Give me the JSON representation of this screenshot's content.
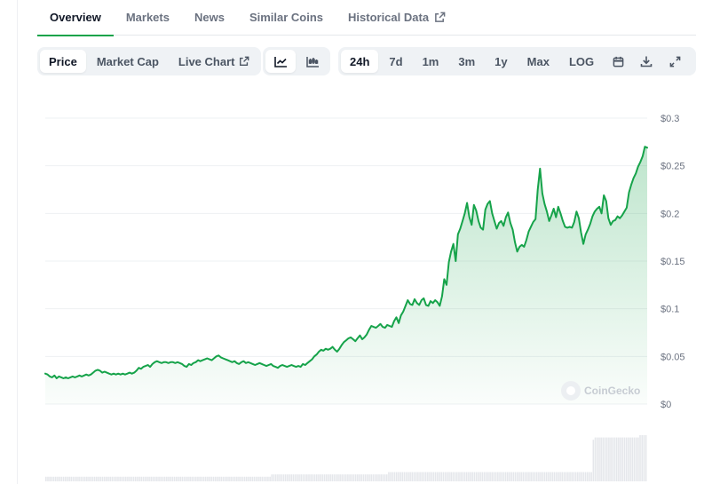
{
  "tabs": [
    {
      "label": "Overview",
      "active": true
    },
    {
      "label": "Markets"
    },
    {
      "label": "News"
    },
    {
      "label": "Similar Coins"
    },
    {
      "label": "Historical Data",
      "external": true
    }
  ],
  "toolbar": {
    "metrics": {
      "price": "Price",
      "market_cap": "Market Cap",
      "live_chart": "Live Chart"
    },
    "chart_types": [
      "line-chart-icon",
      "candlestick-icon"
    ],
    "ranges": [
      "24h",
      "7d",
      "1m",
      "3m",
      "1y",
      "Max",
      "LOG"
    ],
    "active_range": "24h",
    "actions": [
      "calendar-icon",
      "download-icon",
      "fullscreen-icon"
    ]
  },
  "colors": {
    "line": "#16a34a",
    "fill": "#16a34a",
    "volume": "#e5e7eb",
    "grid": "#eef0f3",
    "tick": "#6b7280"
  },
  "watermark": "CoinGecko",
  "chart_data": {
    "type": "area",
    "title": "",
    "xlabel": "",
    "ylabel": "",
    "ylim": [
      0,
      0.3
    ],
    "y_ticks": [
      0,
      0.05,
      0.1,
      0.15,
      0.2,
      0.25,
      0.3
    ],
    "y_tick_labels": [
      "$0",
      "$0.05",
      "$0.1",
      "$0.15",
      "$0.2",
      "$0.25",
      "$0.3"
    ],
    "grid": true,
    "series": [
      {
        "values": [
          0.032,
          0.031,
          0.029,
          0.028,
          0.03,
          0.027,
          0.029,
          0.028,
          0.027,
          0.028,
          0.027,
          0.028,
          0.029,
          0.028,
          0.029,
          0.03,
          0.029,
          0.03,
          0.031,
          0.03,
          0.031,
          0.033,
          0.035,
          0.036,
          0.035,
          0.033,
          0.034,
          0.033,
          0.032,
          0.031,
          0.032,
          0.031,
          0.032,
          0.031,
          0.032,
          0.031,
          0.032,
          0.033,
          0.032,
          0.033,
          0.035,
          0.038,
          0.037,
          0.039,
          0.04,
          0.041,
          0.039,
          0.042,
          0.044,
          0.045,
          0.044,
          0.043,
          0.044,
          0.044,
          0.043,
          0.044,
          0.044,
          0.043,
          0.044,
          0.043,
          0.042,
          0.04,
          0.039,
          0.042,
          0.041,
          0.043,
          0.044,
          0.046,
          0.045,
          0.046,
          0.047,
          0.048,
          0.047,
          0.046,
          0.048,
          0.05,
          0.051,
          0.049,
          0.048,
          0.047,
          0.046,
          0.045,
          0.044,
          0.045,
          0.043,
          0.042,
          0.044,
          0.045,
          0.043,
          0.044,
          0.043,
          0.042,
          0.041,
          0.042,
          0.043,
          0.042,
          0.041,
          0.04,
          0.041,
          0.042,
          0.04,
          0.039,
          0.038,
          0.04,
          0.041,
          0.04,
          0.039,
          0.04,
          0.041,
          0.04,
          0.039,
          0.04,
          0.039,
          0.042,
          0.041,
          0.043,
          0.045,
          0.047,
          0.05,
          0.052,
          0.055,
          0.057,
          0.056,
          0.058,
          0.057,
          0.058,
          0.06,
          0.057,
          0.055,
          0.058,
          0.062,
          0.065,
          0.067,
          0.069,
          0.07,
          0.068,
          0.066,
          0.069,
          0.072,
          0.068,
          0.07,
          0.073,
          0.078,
          0.082,
          0.081,
          0.08,
          0.082,
          0.084,
          0.081,
          0.08,
          0.083,
          0.082,
          0.081,
          0.087,
          0.091,
          0.085,
          0.093,
          0.097,
          0.103,
          0.109,
          0.105,
          0.104,
          0.11,
          0.106,
          0.104,
          0.109,
          0.111,
          0.104,
          0.103,
          0.108,
          0.106,
          0.109,
          0.107,
          0.103,
          0.113,
          0.131,
          0.125,
          0.149,
          0.16,
          0.168,
          0.15,
          0.178,
          0.184,
          0.192,
          0.2,
          0.211,
          0.196,
          0.188,
          0.209,
          0.203,
          0.192,
          0.185,
          0.183,
          0.204,
          0.21,
          0.213,
          0.2,
          0.192,
          0.184,
          0.19,
          0.192,
          0.187,
          0.196,
          0.201,
          0.19,
          0.183,
          0.17,
          0.16,
          0.165,
          0.167,
          0.165,
          0.172,
          0.181,
          0.186,
          0.191,
          0.194,
          0.225,
          0.247,
          0.221,
          0.21,
          0.202,
          0.192,
          0.198,
          0.205,
          0.196,
          0.207,
          0.2,
          0.192,
          0.186,
          0.185,
          0.186,
          0.185,
          0.191,
          0.202,
          0.195,
          0.18,
          0.168,
          0.178,
          0.183,
          0.189,
          0.197,
          0.202,
          0.205,
          0.207,
          0.2,
          0.219,
          0.213,
          0.195,
          0.188,
          0.192,
          0.193,
          0.197,
          0.195,
          0.198,
          0.202,
          0.206,
          0.222,
          0.23,
          0.237,
          0.242,
          0.249,
          0.254,
          0.26,
          0.27,
          0.269
        ]
      }
    ],
    "volume": [
      2,
      2,
      2,
      2,
      2,
      2,
      2,
      2,
      2,
      2,
      2,
      2,
      2,
      2,
      2,
      2,
      2,
      2,
      2,
      2,
      2,
      2,
      2,
      2,
      2,
      2,
      2,
      2,
      2,
      2,
      2,
      2,
      2,
      2,
      2,
      2,
      2,
      2,
      2,
      2,
      2,
      2,
      2,
      2,
      2,
      2,
      2,
      2,
      2,
      2,
      2,
      2,
      2,
      2,
      2,
      2,
      2,
      2,
      2,
      2,
      2,
      2,
      2,
      2,
      2,
      2,
      2,
      2,
      2,
      2,
      2,
      2,
      2,
      2,
      2,
      2,
      2,
      2,
      2,
      2,
      2,
      2,
      2,
      2,
      2,
      2,
      2,
      2,
      2,
      2,
      2,
      2,
      2,
      2,
      2,
      2,
      2,
      2,
      2,
      2,
      2,
      2,
      2,
      2,
      2,
      2,
      2,
      2,
      2,
      2,
      2,
      2,
      2,
      2,
      2,
      2,
      3,
      3,
      3,
      3,
      3,
      3,
      3,
      3,
      3,
      3,
      3,
      3,
      3,
      3,
      3,
      3,
      3,
      3,
      3,
      3,
      3,
      3,
      3,
      3,
      3,
      3,
      3,
      3,
      3,
      3,
      3,
      3,
      3,
      3,
      3,
      3,
      3,
      3,
      3,
      3,
      3,
      3,
      3,
      3,
      3,
      3,
      3,
      3,
      3,
      3,
      3,
      3,
      3,
      3,
      3,
      3,
      3,
      3,
      3,
      3,
      4,
      4,
      4,
      4,
      4,
      4,
      4,
      4,
      4,
      4,
      4,
      4,
      4,
      4,
      4,
      4,
      4,
      4,
      4,
      4,
      4,
      4,
      4,
      4,
      4,
      4,
      4,
      4,
      4,
      4,
      4,
      4,
      4,
      4,
      4,
      4,
      4,
      4,
      4,
      4,
      4,
      4,
      4,
      4,
      4,
      4,
      4,
      4,
      4,
      4,
      4,
      4,
      4,
      4,
      4,
      4,
      4,
      4,
      4,
      4,
      4,
      4,
      4,
      4,
      4,
      4,
      4,
      4,
      4,
      4,
      4,
      4,
      4,
      4,
      4,
      4,
      4,
      4,
      4,
      4,
      4,
      4,
      4,
      4,
      4,
      4,
      4,
      4,
      4,
      4,
      4,
      4,
      4,
      4,
      4,
      4,
      4,
      4,
      4,
      4,
      4,
      4,
      4,
      4,
      4,
      18,
      19,
      19,
      19,
      19,
      19,
      19,
      19,
      19,
      19,
      19,
      19,
      19,
      19,
      19,
      19,
      19,
      19,
      19,
      19,
      19,
      19,
      19,
      19,
      20,
      20,
      20,
      20
    ]
  }
}
